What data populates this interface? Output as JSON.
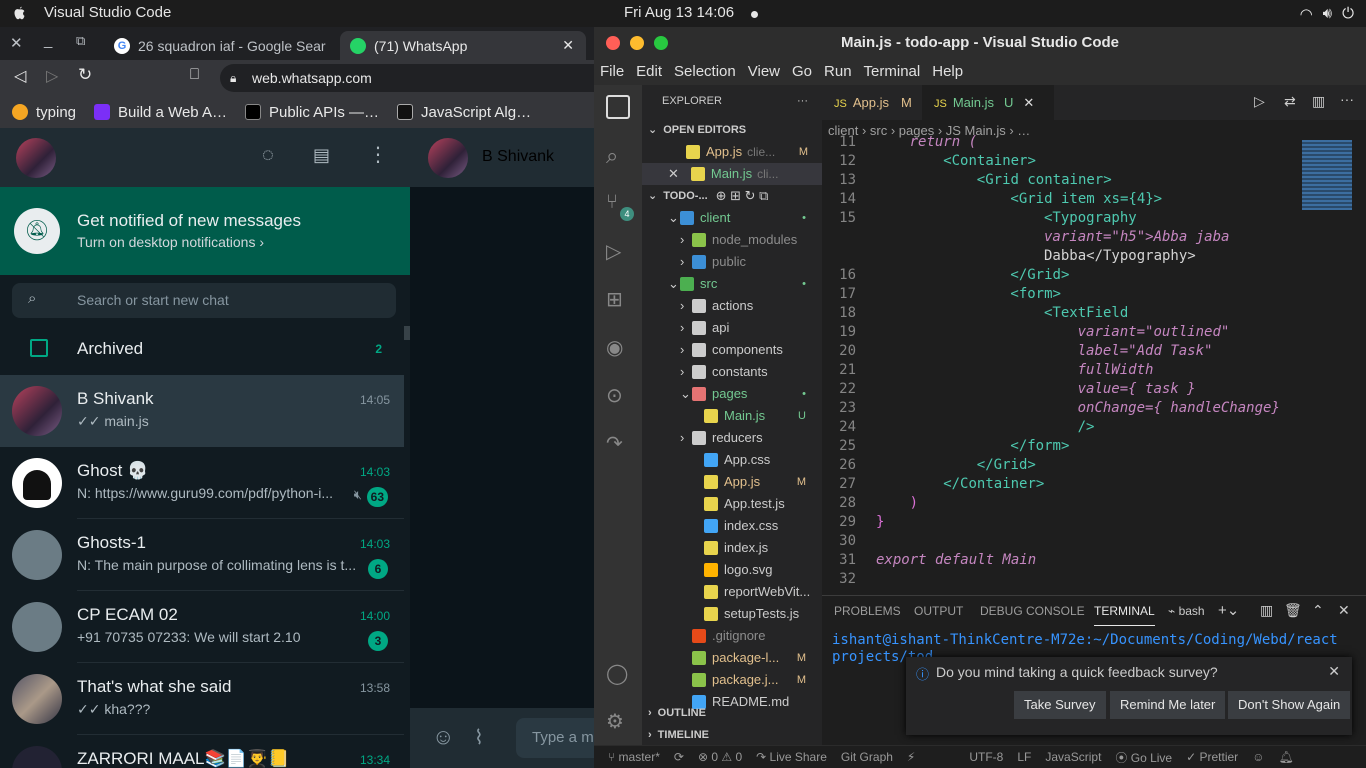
{
  "topbar": {
    "app_name": "Visual Studio Code",
    "clock": "Fri Aug 13  14:06"
  },
  "chrome": {
    "tabs": [
      {
        "label": "26 squadron iaf - Google Sear"
      },
      {
        "label": "(71) WhatsApp"
      }
    ],
    "url": "web.whatsapp.com",
    "bookmarks": [
      "typing",
      "Build a Web A…",
      "Public APIs —…",
      "JavaScript Alg…"
    ]
  },
  "whatsapp": {
    "notify_title": "Get notified of new messages",
    "notify_sub": "Turn on desktop notifications ›",
    "search_placeholder": "Search or start new chat",
    "archived_label": "Archived",
    "archived_count": "2",
    "contact_header": "B Shivank",
    "compose_placeholder": "Type a m",
    "chats": [
      {
        "name": "B Shivank",
        "msg": "✓✓ main.js",
        "time": "14:05",
        "badge": ""
      },
      {
        "name": "Ghost 💀",
        "msg": "N: https://www.guru99.com/pdf/python-i...",
        "time": "14:03",
        "badge": "63"
      },
      {
        "name": "Ghosts-1",
        "msg": "N: The main purpose of collimating lens is t...",
        "time": "14:03",
        "badge": "6"
      },
      {
        "name": "CP ECAM 02",
        "msg": "+91 70735 07233: We will start 2.10",
        "time": "14:00",
        "badge": "3"
      },
      {
        "name": "That's what she said",
        "msg": "✓✓ kha???",
        "time": "13:58",
        "badge": ""
      },
      {
        "name": "ZARRORI MAAL📚📄👨‍🎓📒",
        "msg": "",
        "time": "13:34",
        "badge": ""
      }
    ]
  },
  "vscode": {
    "title": "Main.js - todo-app - Visual Studio Code",
    "menu": [
      "File",
      "Edit",
      "Selection",
      "View",
      "Go",
      "Run",
      "Terminal",
      "Help"
    ],
    "explorer_label": "EXPLORER",
    "open_editors_label": "OPEN EDITORS",
    "open_editors": [
      {
        "name": "App.js",
        "path": "clie...",
        "status": "M"
      },
      {
        "name": "Main.js",
        "path": "cli...",
        "status": "U"
      }
    ],
    "project_label": "TODO-...",
    "tree": [
      {
        "name": "client",
        "status": "•"
      },
      {
        "name": "node_modules",
        "status": ""
      },
      {
        "name": "public",
        "status": ""
      },
      {
        "name": "src",
        "status": "•"
      },
      {
        "name": "actions",
        "status": ""
      },
      {
        "name": "api",
        "status": ""
      },
      {
        "name": "components",
        "status": ""
      },
      {
        "name": "constants",
        "status": ""
      },
      {
        "name": "pages",
        "status": "•"
      },
      {
        "name": "Main.js",
        "status": "U"
      },
      {
        "name": "reducers",
        "status": ""
      },
      {
        "name": "App.css",
        "status": ""
      },
      {
        "name": "App.js",
        "status": "M"
      },
      {
        "name": "App.test.js",
        "status": ""
      },
      {
        "name": "index.css",
        "status": ""
      },
      {
        "name": "index.js",
        "status": ""
      },
      {
        "name": "logo.svg",
        "status": ""
      },
      {
        "name": "reportWebVit...",
        "status": ""
      },
      {
        "name": "setupTests.js",
        "status": ""
      },
      {
        "name": ".gitignore",
        "status": ""
      },
      {
        "name": "package-l...",
        "status": "M"
      },
      {
        "name": "package.j...",
        "status": "M"
      },
      {
        "name": "README.md",
        "status": ""
      }
    ],
    "outline_label": "OUTLINE",
    "timeline_label": "TIMELINE",
    "editor_tabs": [
      {
        "name": "App.js",
        "status": "M"
      },
      {
        "name": "Main.js",
        "status": "U"
      }
    ],
    "breadcrumb": "client › src › pages › JS Main.js › …",
    "code_lines": [
      {
        "n": "11",
        "html": "return ("
      },
      {
        "n": "12",
        "html": "<Container>"
      },
      {
        "n": "13",
        "html": "<Grid container>"
      },
      {
        "n": "14",
        "html": "<Grid item xs={4}>"
      },
      {
        "n": "15",
        "html": "<Typography"
      },
      {
        "n": "",
        "html": "variant=\"h5\">Abba jaba"
      },
      {
        "n": "",
        "html": "Dabba</Typography>"
      },
      {
        "n": "16",
        "html": "</Grid>"
      },
      {
        "n": "17",
        "html": "<form>"
      },
      {
        "n": "18",
        "html": "<TextField"
      },
      {
        "n": "19",
        "html": "variant=\"outlined\""
      },
      {
        "n": "20",
        "html": "label=\"Add Task\""
      },
      {
        "n": "21",
        "html": "fullWidth"
      },
      {
        "n": "22",
        "html": "value={ task }"
      },
      {
        "n": "23",
        "html": "onChange={ handleChange}"
      },
      {
        "n": "24",
        "html": "/>"
      },
      {
        "n": "25",
        "html": "</form>"
      },
      {
        "n": "26",
        "html": "</Grid>"
      },
      {
        "n": "27",
        "html": "</Container>"
      },
      {
        "n": "28",
        "html": ")"
      },
      {
        "n": "29",
        "html": "}"
      },
      {
        "n": "30",
        "html": ""
      },
      {
        "n": "31",
        "html": "export default Main"
      },
      {
        "n": "32",
        "html": ""
      }
    ],
    "panel_tabs": [
      "PROBLEMS",
      "OUTPUT",
      "DEBUG CONSOLE",
      "TERMINAL"
    ],
    "shell": "bash",
    "terminal_text": "ishant@ishant-ThinkCentre-M72e:~/Documents/Coding/Webd/react projects/tod",
    "survey": {
      "question": "Do you mind taking a quick feedback survey?",
      "take": "Take Survey",
      "remind": "Remind Me later",
      "dont": "Don't Show Again"
    },
    "status": [
      "master*",
      "⊗ 0 ⚠ 0",
      "Live Share",
      "Git Graph",
      "UTF-8",
      "LF",
      "JavaScript",
      "Go Live",
      "Prettier"
    ]
  }
}
